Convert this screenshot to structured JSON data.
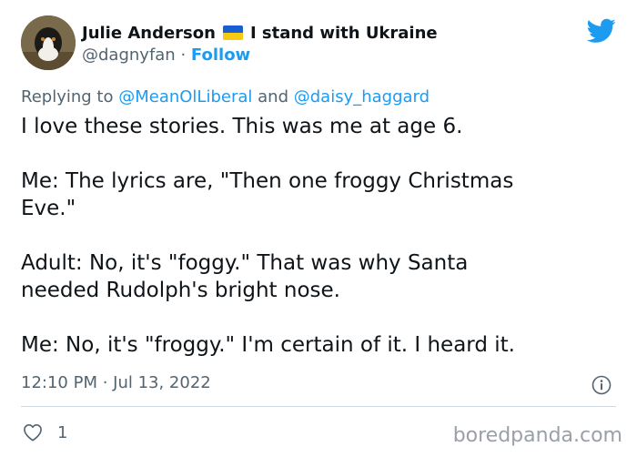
{
  "author": {
    "display_name": "Julie Anderson",
    "name_suffix": "I stand with Ukraine",
    "handle": "@dagnyfan",
    "separator": "·",
    "follow_label": "Follow"
  },
  "reply": {
    "prefix": "Replying to",
    "mention_1": "@MeanOlLiberal",
    "conjunction": "and",
    "mention_2": "@daisy_haggard"
  },
  "tweet": {
    "lines": [
      "I love these stories. This was me at age 6.",
      "",
      "Me: The lyrics are, \"Then one froggy Christmas",
      "Eve.\"",
      "",
      "Adult: No, it's \"foggy.\"  That was why Santa",
      "needed Rudolph's bright nose.",
      "",
      "Me: No, it's \"froggy.\" I'm certain of it. I heard it."
    ],
    "timestamp": "12:10 PM · Jul 13, 2022",
    "like_count": "1"
  },
  "watermark": "boredpanda.com",
  "colors": {
    "link": "#1d9bf0",
    "muted": "#536471",
    "flag_blue": "#1a5fd1",
    "flag_yellow": "#f6c915"
  },
  "icons": [
    "twitter-bird-icon",
    "info-icon",
    "heart-icon",
    "ukraine-flag-icon"
  ]
}
